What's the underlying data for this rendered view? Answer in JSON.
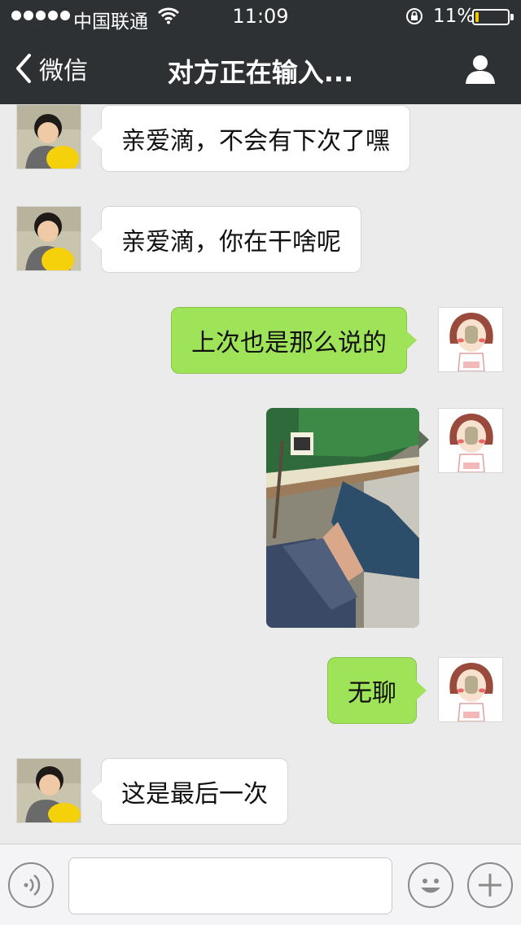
{
  "status_bar": {
    "carrier": "中国联通",
    "time": "11:09",
    "battery_percent_label": "11%",
    "battery_level": 0.11,
    "signal_icon": "signal-dots-icon",
    "wifi_icon": "wifi-icon",
    "lock_icon": "orientation-lock-icon"
  },
  "nav": {
    "back_label": "微信",
    "title": "对方正在输入...",
    "back_icon": "chevron-left-icon",
    "profile_icon": "person-icon"
  },
  "messages": [
    {
      "side": "left",
      "text": "亲爱滴，不会有下次了嘿"
    },
    {
      "side": "left",
      "text": "亲爱滴，你在干啥呢"
    },
    {
      "side": "right",
      "text": "上次也是那么说的"
    },
    {
      "side": "right",
      "type": "image"
    },
    {
      "side": "right",
      "text": "无聊"
    },
    {
      "side": "left",
      "text": "这是最后一次"
    }
  ],
  "input_bar": {
    "voice_icon": "voice-icon",
    "emoji_icon": "emoji-icon",
    "plus_icon": "plus-icon",
    "input_value": ""
  },
  "colors": {
    "nav_bg": "#2e3133",
    "chat_bg": "#ebebeb",
    "sent_bubble": "#9fe358",
    "received_bubble": "#ffffff",
    "battery": "#f2c500"
  }
}
